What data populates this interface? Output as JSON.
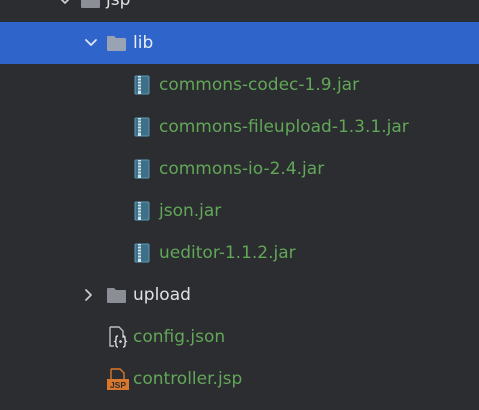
{
  "tree": {
    "jsp_folder": {
      "label": "jsp",
      "expanded": true
    },
    "lib_folder": {
      "label": "lib",
      "expanded": true,
      "selected": true
    },
    "lib_items": [
      {
        "label": "commons-codec-1.9.jar",
        "icon": "jar-icon"
      },
      {
        "label": "commons-fileupload-1.3.1.jar",
        "icon": "jar-icon"
      },
      {
        "label": "commons-io-2.4.jar",
        "icon": "jar-icon"
      },
      {
        "label": "json.jar",
        "icon": "jar-icon"
      },
      {
        "label": "ueditor-1.1.2.jar",
        "icon": "jar-icon"
      }
    ],
    "upload_folder": {
      "label": "upload",
      "expanded": false
    },
    "config_file": {
      "label": "config.json",
      "icon": "json-file-icon"
    },
    "controller_file": {
      "label": "controller.jsp",
      "icon": "jsp-file-icon",
      "icon_text": "JSP"
    }
  },
  "colors": {
    "background": "#2b2d30",
    "selection": "#2f65ca",
    "excluded_green": "#62a758",
    "text_light": "#dfe1e5",
    "folder_gray": "#8b8e94",
    "jsp_orange": "#d9782d"
  }
}
